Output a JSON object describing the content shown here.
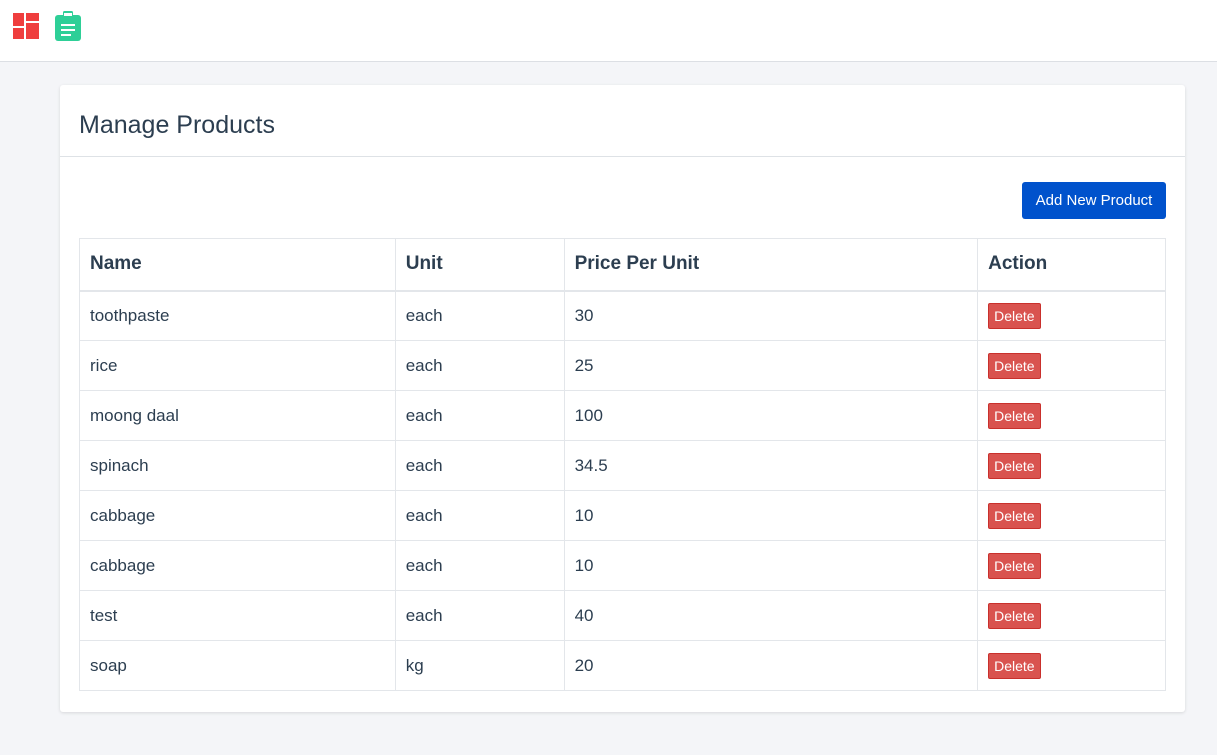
{
  "header": {
    "icons": [
      "dashboard-icon",
      "clipboard-icon"
    ],
    "colors": {
      "dashboard": "#ef3e3e",
      "clipboard": "#2ecf97"
    }
  },
  "card": {
    "title": "Manage Products",
    "add_button_label": "Add New Product"
  },
  "table": {
    "columns": [
      "Name",
      "Unit",
      "Price Per Unit",
      "Action"
    ],
    "rows": [
      {
        "name": "toothpaste",
        "unit": "each",
        "price": "30",
        "action": "Delete"
      },
      {
        "name": "rice",
        "unit": "each",
        "price": "25",
        "action": "Delete"
      },
      {
        "name": "moong daal",
        "unit": "each",
        "price": "100",
        "action": "Delete"
      },
      {
        "name": "spinach",
        "unit": "each",
        "price": "34.5",
        "action": "Delete"
      },
      {
        "name": "cabbage",
        "unit": "each",
        "price": "10",
        "action": "Delete"
      },
      {
        "name": "cabbage",
        "unit": "each",
        "price": "10",
        "action": "Delete"
      },
      {
        "name": "test",
        "unit": "each",
        "price": "40",
        "action": "Delete"
      },
      {
        "name": "soap",
        "unit": "kg",
        "price": "20",
        "action": "Delete"
      }
    ]
  },
  "colors": {
    "primary": "#0052cc",
    "danger": "#d9534f",
    "text": "#2c3e50"
  }
}
